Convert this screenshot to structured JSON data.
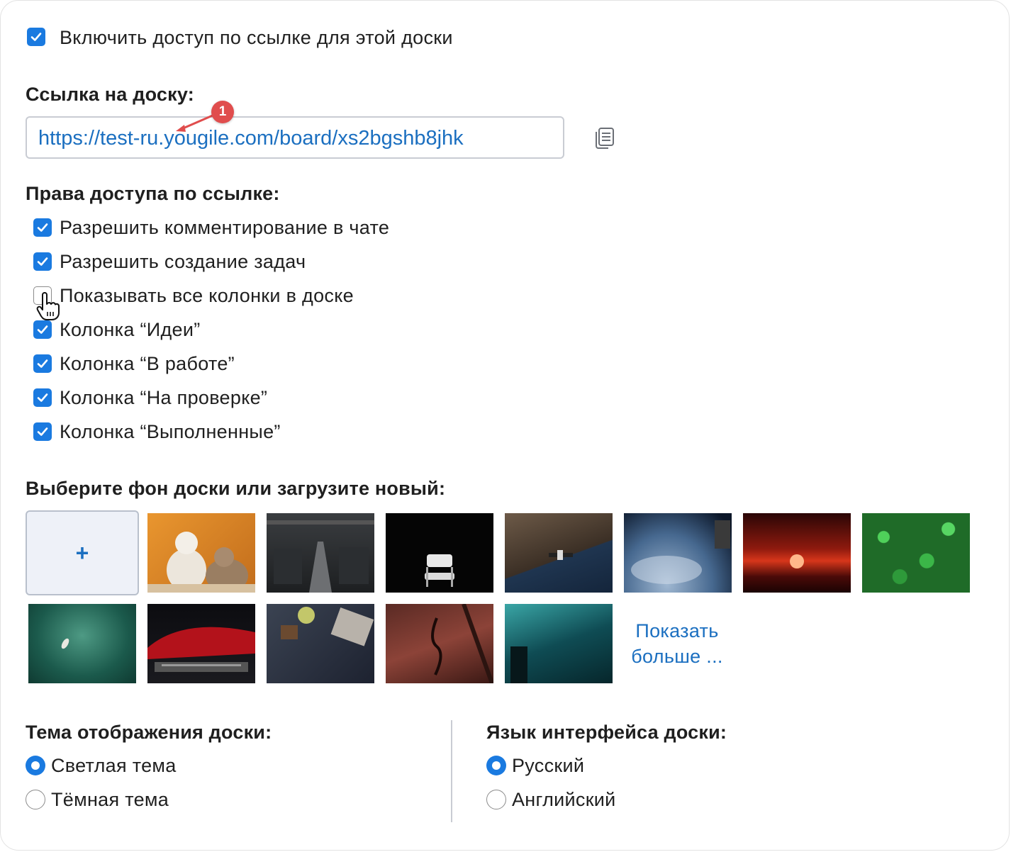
{
  "enable_link": {
    "label": "Включить доступ по ссылке для этой доски",
    "checked": true
  },
  "link_section": {
    "heading": "Ссылка на доску:",
    "url": "https://test-ru.yougile.com/board/xs2bgshb8jhk",
    "badge": "1",
    "copy_icon": "copy-icon"
  },
  "permissions": {
    "heading": "Права доступа по ссылке:",
    "items": [
      {
        "label": "Разрешить комментирование в чате",
        "checked": true
      },
      {
        "label": "Разрешить создание задач",
        "checked": true
      },
      {
        "label": "Показывать все колонки в доске",
        "checked": false
      },
      {
        "label": "Колонка “Идеи”",
        "checked": true
      },
      {
        "label": "Колонка “В работе”",
        "checked": true
      },
      {
        "label": "Колонка “На проверке”",
        "checked": true
      },
      {
        "label": "Колонка “Выполненные”",
        "checked": true
      }
    ]
  },
  "background": {
    "heading": "Выберите фон доски или загрузите новый:",
    "add_label": "+",
    "show_more_line1": "Показать",
    "show_more_line2": "больше ...",
    "images": [
      "cats",
      "factory",
      "chair",
      "coast-satellite",
      "earth-orbit",
      "sunset",
      "green-leaves",
      "aerial-water",
      "red-car",
      "desk-laptop",
      "cello",
      "underwater"
    ]
  },
  "theme": {
    "heading": "Тема отображения доски:",
    "options": [
      {
        "label": "Светлая тема",
        "selected": true
      },
      {
        "label": "Тёмная тема",
        "selected": false
      }
    ]
  },
  "language": {
    "heading": "Язык интерфейса доски:",
    "options": [
      {
        "label": "Русский",
        "selected": true
      },
      {
        "label": "Английский",
        "selected": false
      }
    ]
  },
  "colors": {
    "accent": "#1a7ae0",
    "link": "#1b6fc0",
    "badge": "#e04d4d"
  }
}
